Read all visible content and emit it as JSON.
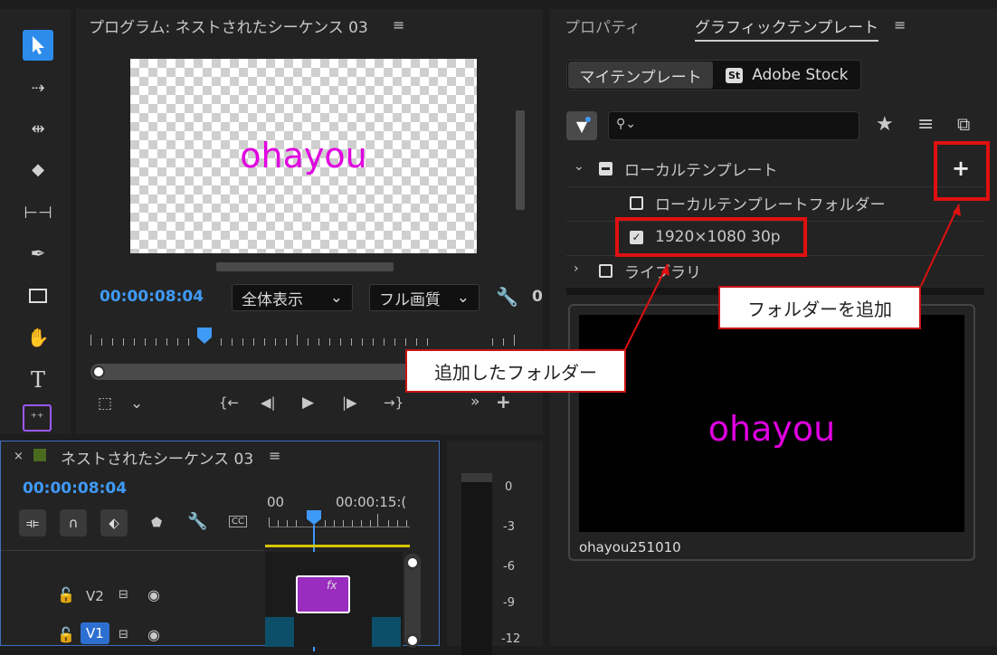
{
  "program": {
    "title": "プログラム: ネストされたシーケンス 03",
    "preview_text": "ohayou",
    "timecode": "00:00:08:04",
    "fit_dropdown": "全体表示",
    "quality_dropdown": "フル画質",
    "right_number": "0"
  },
  "right_panel": {
    "tab_properties": "プロパティ",
    "tab_graphic_templates": "グラフィックテンプレート",
    "subtab_my_templates": "マイテンプレート",
    "subtab_adobe_stock": "Adobe Stock",
    "stock_badge": "St",
    "tree": {
      "local_templates": "ローカルテンプレート",
      "local_folder": "ローカルテンプレートフォルダー",
      "added_folder": "1920×1080 30p",
      "library": "ライブラリ"
    },
    "preview_text": "ohayou",
    "preview_caption": "ohayou251010"
  },
  "timeline": {
    "title": "ネストされたシーケンス 03",
    "timecode": "00:00:08:04",
    "ruler_start": "00",
    "ruler_mark": "00:00:15:(",
    "track_v2": "V2",
    "track_v1": "V1",
    "clip_fx": "fx",
    "cc_label": "CC"
  },
  "meter": {
    "labels": [
      "0",
      "-3",
      "-6",
      "-9",
      "-12"
    ]
  },
  "annotations": {
    "added_folder_callout": "追加したフォルダー",
    "add_folder_callout": "フォルダーを追加"
  },
  "colors": {
    "accent_blue": "#3f9af7",
    "magenta_text": "#e000e0",
    "annotation_red": "#e01010"
  }
}
